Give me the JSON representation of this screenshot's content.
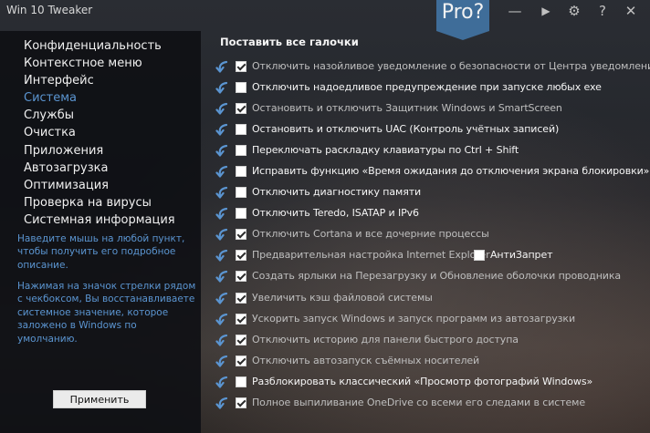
{
  "window": {
    "title": "Win 10 Tweaker",
    "pro_badge": "Pro?",
    "icons": [
      "minimize-icon",
      "play-icon",
      "gear-icon",
      "help-icon",
      "close-icon"
    ],
    "glyphs": {
      "minimize": "—",
      "play": "▶",
      "settings": "⚙",
      "help": "?",
      "close": "✕"
    }
  },
  "sidebar": {
    "items": [
      {
        "label": "Конфиденциальность",
        "active": false
      },
      {
        "label": "Контекстное меню",
        "active": false
      },
      {
        "label": "Интерфейс",
        "active": false
      },
      {
        "label": "Система",
        "active": true
      },
      {
        "label": "Службы",
        "active": false
      },
      {
        "label": "Очистка",
        "active": false
      },
      {
        "label": "Приложения",
        "active": false
      },
      {
        "label": "Автозагрузка",
        "active": false
      },
      {
        "label": "Оптимизация",
        "active": false
      },
      {
        "label": "Проверка на вирусы",
        "active": false
      },
      {
        "label": "Системная информация",
        "active": false
      }
    ],
    "hint1": "Наведите мышь на любой пункт, чтобы получить его подробное описание.",
    "hint2": "Нажимая на значок стрелки рядом с чекбоксом, Вы восстанавливаете системное значение, которое заложено в Windows по умолчанию.",
    "apply_label": "Применить"
  },
  "main": {
    "header": "Поставить все галочки",
    "options": [
      {
        "label": "Отключить назойливое уведомление о безопасности от Центра уведомлений",
        "checked": true
      },
      {
        "label": "Отключить надоедливое предупреждение при запуске любых exe",
        "checked": false
      },
      {
        "label": "Остановить и отключить Защитник Windows и SmartScreen",
        "checked": true
      },
      {
        "label": "Остановить и отключить UAC (Контроль учётных записей)",
        "checked": false
      },
      {
        "label": "Переключать раскладку клавиатуры по Ctrl + Shift",
        "checked": false
      },
      {
        "label": "Исправить функцию «Время ожидания до отключения экрана блокировки»",
        "checked": false
      },
      {
        "label": "Отключить диагностику памяти",
        "checked": false
      },
      {
        "label": "Отключить Teredo, ISATAP и IPv6",
        "checked": false
      },
      {
        "label": "Отключить Cortana и все дочерние процессы",
        "checked": true
      },
      {
        "label": "Предварительная настройка Internet Explorer",
        "checked": true,
        "extra": {
          "label": "АнтиЗапрет",
          "checked": false
        }
      },
      {
        "label": "Создать ярлыки на Перезагрузку и Обновление оболочки проводника",
        "checked": true
      },
      {
        "label": "Увеличить кэш файловой системы",
        "checked": true
      },
      {
        "label": "Ускорить запуск Windows и запуск программ из автозагрузки",
        "checked": true
      },
      {
        "label": "Отключить историю для панели быстрого доступа",
        "checked": true
      },
      {
        "label": "Отключить автозапуск съёмных носителей",
        "checked": true
      },
      {
        "label": "Разблокировать классический «Просмотр фотографий Windows»",
        "checked": false
      },
      {
        "label": "Полное выпиливание OneDrive со всеми его следами в системе",
        "checked": true
      }
    ]
  },
  "colors": {
    "accent": "#5b95d1",
    "pro_badge": "#3f6d99",
    "arrow": "#5b95d1"
  }
}
